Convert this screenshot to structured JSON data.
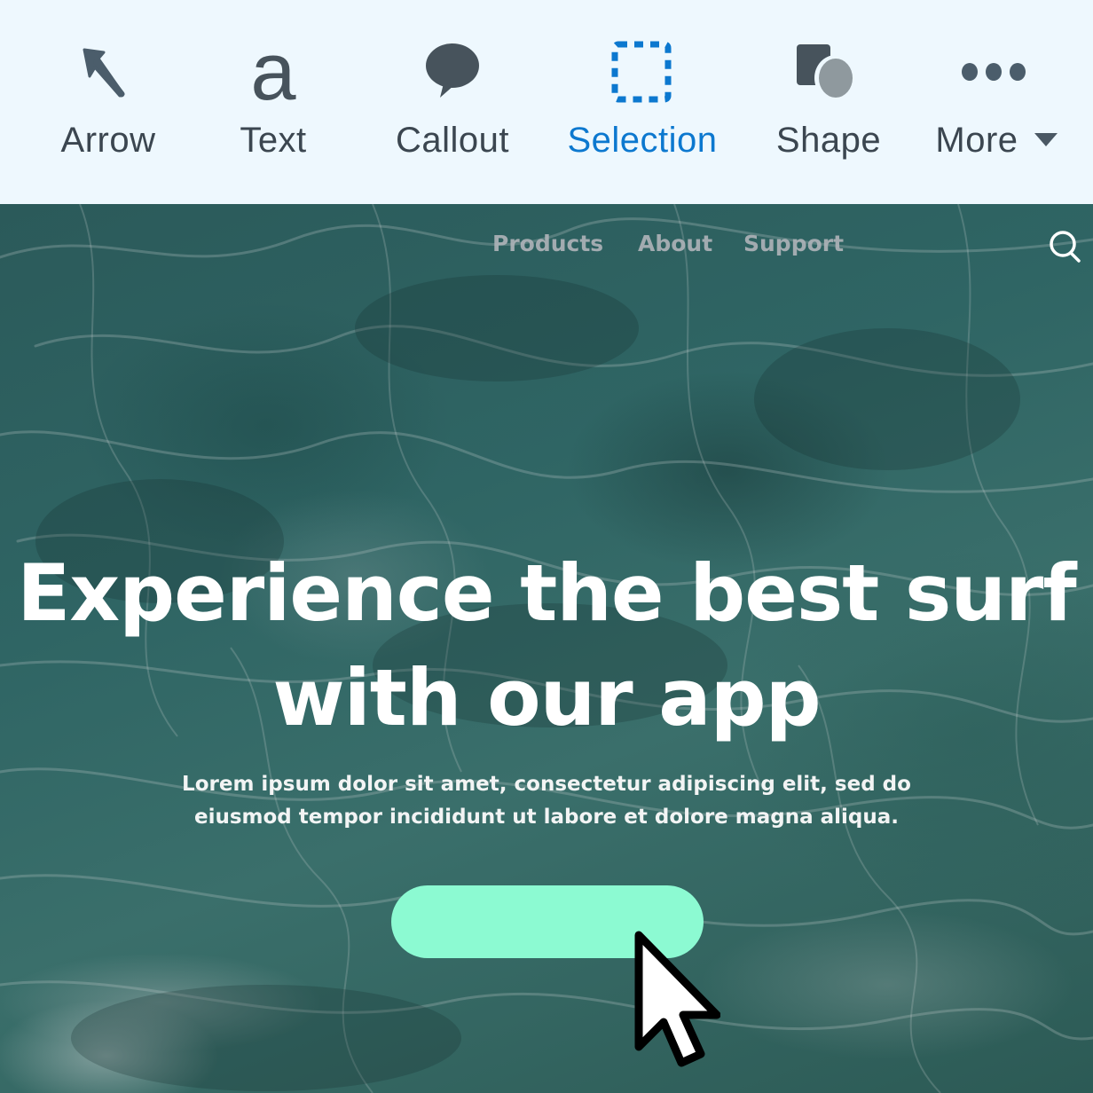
{
  "toolbar": {
    "tools": [
      {
        "label": "Arrow",
        "icon": "arrow-icon"
      },
      {
        "label": "Text",
        "icon": "text-icon"
      },
      {
        "label": "Callout",
        "icon": "callout-icon"
      },
      {
        "label": "Selection",
        "icon": "selection-icon",
        "active": true
      },
      {
        "label": "Shape",
        "icon": "shape-icon"
      },
      {
        "label": "More",
        "icon": "more-icon"
      }
    ],
    "text_glyph": "a",
    "active_color": "#0c78cf",
    "icon_color": "#47535c"
  },
  "website": {
    "nav": {
      "links": [
        "Products",
        "About",
        "Support"
      ],
      "search_icon": "search-icon"
    },
    "hero": {
      "headline_line1": "Experience the best surf",
      "headline_line2": "with our app",
      "subtext_line1": "Lorem ipsum dolor sit amet, consectetur adipiscing elit, sed do",
      "subtext_line2": "eiusmod tempor incididunt ut labore et dolore magna aliqua.",
      "cta_color": "#8cfad2"
    }
  }
}
